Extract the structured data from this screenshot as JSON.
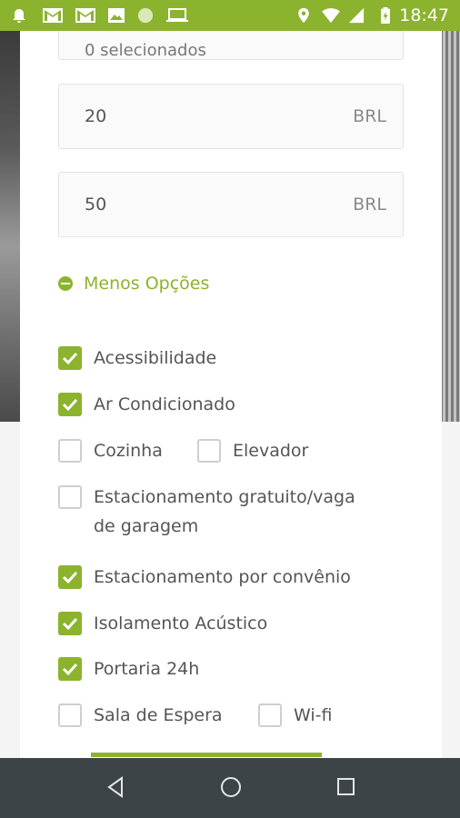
{
  "status_bar": {
    "time": "18:47",
    "icons": [
      "notification-bell-icon",
      "gmail-icon",
      "gmail-icon",
      "image-icon",
      "circle-icon",
      "laptop-icon",
      "location-icon",
      "wifi-icon",
      "signal-icon",
      "battery-charging-icon"
    ]
  },
  "filters": {
    "top_field_text": "0 selecionados",
    "min_price": {
      "value": "20",
      "unit": "BRL"
    },
    "max_price": {
      "value": "50",
      "unit": "BRL"
    },
    "less_options_label": "Menos Opções",
    "amenities": [
      {
        "label": "Acessibilidade",
        "checked": true
      },
      {
        "label": "Ar Condicionado",
        "checked": true
      },
      {
        "label": "Cozinha",
        "checked": false
      },
      {
        "label": "Elevador",
        "checked": false
      },
      {
        "label": "Estacionamento gratuito/vaga",
        "label_line2": "de garagem",
        "checked": false
      },
      {
        "label": "Estacionamento por convênio",
        "checked": true
      },
      {
        "label": "Isolamento Acústico",
        "checked": true
      },
      {
        "label": "Portaria 24h",
        "checked": true
      },
      {
        "label": "Sala de Espera",
        "checked": false
      },
      {
        "label": "Wi-fi",
        "checked": false
      }
    ]
  },
  "colors": {
    "accent": "#8cb32d",
    "nav_bar": "#3d4447"
  },
  "nav": [
    "back-icon",
    "home-icon",
    "recents-icon"
  ]
}
